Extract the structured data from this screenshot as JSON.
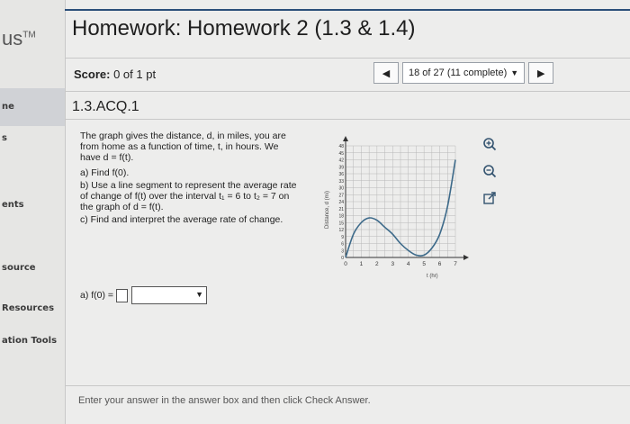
{
  "sidebar": {
    "brand": "us",
    "brand_tm": "TM",
    "items": [
      "ne",
      "s",
      "ents",
      "source",
      "Resources",
      "ation Tools"
    ]
  },
  "header": {
    "title": "Homework: Homework 2 (1.3 & 1.4)",
    "score_label": "Score:",
    "score_value": "0 of 1 pt",
    "question_nav": "18 of 27 (11 complete)"
  },
  "question": {
    "id": "1.3.ACQ.1",
    "intro": "The graph gives the distance, d, in miles, you are from home as a function of time, t, in hours. We have d = f(t).",
    "part_a": "a) Find f(0).",
    "part_b": "b) Use a line segment to represent the average rate of change of f(t) over the interval t₁ = 6 to t₂ = 7 on the graph of d = f(t).",
    "part_c": "c) Find and interpret the average rate of change."
  },
  "answer": {
    "label": "a) f(0) =",
    "value": "",
    "selected_unit": ""
  },
  "instructions": "Enter your answer in the answer box and then click Check Answer.",
  "icons": [
    "prev-arrow-icon",
    "next-arrow-icon",
    "dropdown-caret-icon",
    "zoom-in-icon",
    "zoom-out-icon",
    "pop-out-icon"
  ],
  "colors": {
    "accent": "#2b4f7a",
    "curve": "#3d6a8a"
  },
  "chart_data": {
    "type": "line",
    "xlabel": "t (hr)",
    "ylabel": "Distance, d (mi)",
    "x_ticks": [
      "0",
      "1",
      "2",
      "3",
      "4",
      "5",
      "6",
      "7"
    ],
    "y_ticks": [
      "0",
      "3",
      "6",
      "9",
      "12",
      "15",
      "18",
      "21",
      "24",
      "27",
      "30",
      "33",
      "36",
      "39",
      "42",
      "45",
      "48"
    ],
    "xlim": [
      0,
      7
    ],
    "ylim": [
      0,
      48
    ],
    "grid": true,
    "series": [
      {
        "x": [
          0,
          0.5,
          1,
          1.5,
          2,
          2.5,
          3,
          3.5,
          4,
          4.5,
          5,
          5.5,
          6,
          6.5,
          7
        ],
        "values": [
          0,
          10,
          15,
          17,
          16,
          13,
          10,
          6,
          3,
          1,
          1,
          4,
          10,
          22,
          42
        ]
      }
    ]
  }
}
